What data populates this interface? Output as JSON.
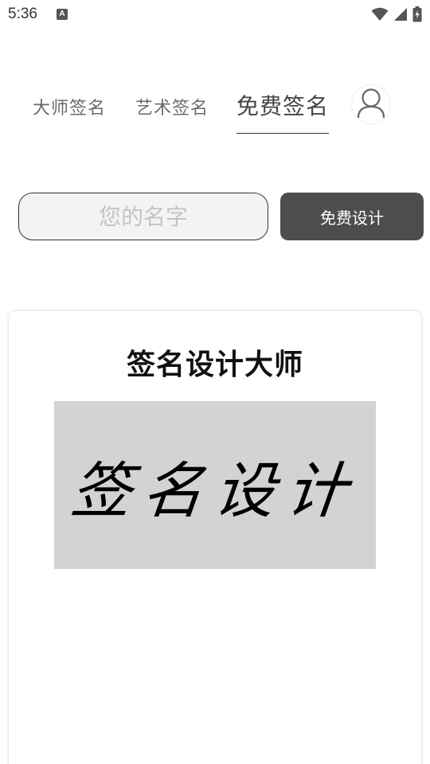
{
  "status_bar": {
    "time": "5:36",
    "notification_icon": "A",
    "icons": [
      "wifi-icon",
      "signal-icon",
      "battery-icon"
    ]
  },
  "tabs": [
    {
      "label": "大师签名",
      "active": false
    },
    {
      "label": "艺术签名",
      "active": false
    },
    {
      "label": "免费签名",
      "active": true
    }
  ],
  "user_icon": "user-icon",
  "form": {
    "name_value": "",
    "name_placeholder": "您的名字",
    "design_button_label": "免费设计"
  },
  "card": {
    "title": "签名设计大师",
    "signature_sample": "签名设计"
  },
  "colors": {
    "button_bg": "#4d4d4d",
    "preview_bg": "#d3d3d3",
    "active_tab": "#444444",
    "inactive_tab": "#6b6b6b"
  }
}
